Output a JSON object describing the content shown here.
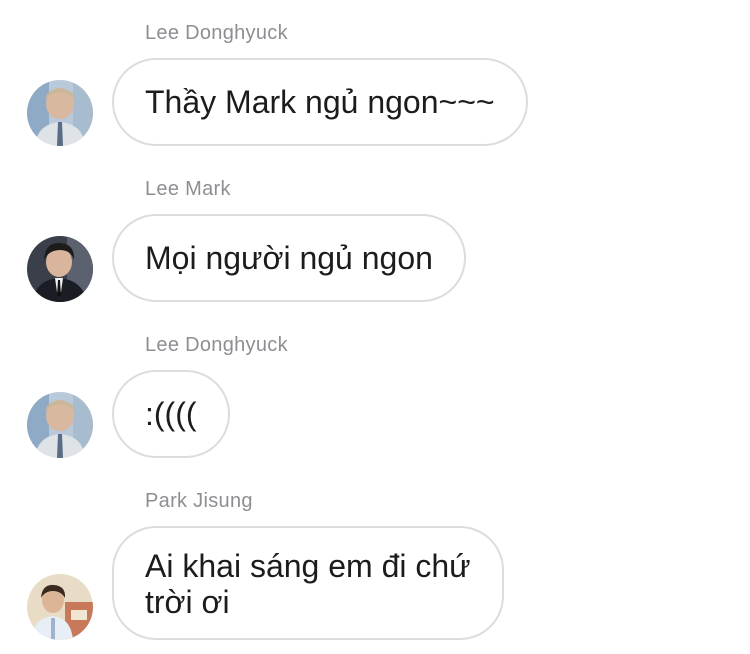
{
  "messages": [
    {
      "sender": "Lee Donghyuck",
      "avatar_icon": "avatar-lee-donghyuck-icon",
      "lines": [
        "Thầy Mark ngủ ngon~~~"
      ]
    },
    {
      "sender": "Lee Mark",
      "avatar_icon": "avatar-lee-mark-icon",
      "lines": [
        "Mọi người ngủ ngon"
      ]
    },
    {
      "sender": "Lee Donghyuck",
      "avatar_icon": "avatar-lee-donghyuck-icon",
      "lines": [
        ":(((("
      ]
    },
    {
      "sender": "Park Jisung",
      "avatar_icon": "avatar-park-jisung-icon",
      "lines": [
        "Ai khai sáng em đi chứ",
        "trời ơi"
      ]
    }
  ],
  "colors": {
    "sender_text": "#8e8e93",
    "bubble_border": "#dcdcdf",
    "message_text": "#1c1c1e",
    "background": "#ffffff"
  }
}
